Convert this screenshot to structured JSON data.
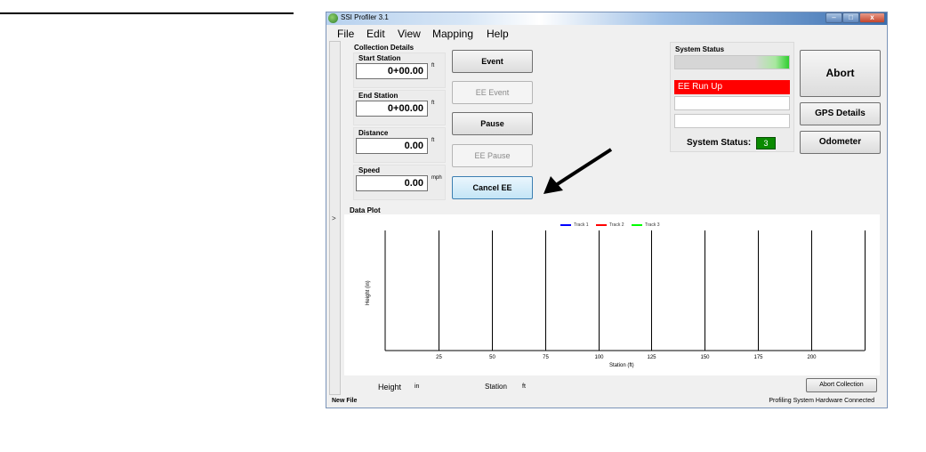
{
  "window": {
    "title": "SSI Profiler 3.1",
    "close_glyph": "x",
    "min_glyph": "–",
    "max_glyph": "□"
  },
  "menu": [
    "File",
    "Edit",
    "View",
    "Mapping",
    "Help"
  ],
  "side_panel": {
    "chevron": ">"
  },
  "collection": {
    "title": "Collection Details",
    "fields": [
      {
        "label": "Start Station",
        "value": "0+00.00",
        "unit": "ft"
      },
      {
        "label": "End Station",
        "value": "0+00.00",
        "unit": "ft"
      },
      {
        "label": "Distance",
        "value": "0.00",
        "unit": "ft"
      },
      {
        "label": "Speed",
        "value": "0.00",
        "unit": "mph"
      }
    ],
    "buttons": {
      "event": "Event",
      "ee_event": "EE Event",
      "pause": "Pause",
      "ee_pause": "EE Pause",
      "cancel_ee": "Cancel EE"
    }
  },
  "system_status": {
    "title": "System Status",
    "rows": [
      "",
      "EE Run Up",
      "",
      ""
    ],
    "status_label": "System Status:",
    "status_code": "3"
  },
  "right_buttons": {
    "abort": "Abort",
    "gps": "GPS Details",
    "odometer": "Odometer"
  },
  "data_plot": {
    "title": "Data Plot",
    "bottom_labels": {
      "height_label": "Height",
      "height_unit": "in",
      "station_label": "Station",
      "station_unit": "ft"
    },
    "abort_collection": "Abort Collection"
  },
  "chart_data": {
    "type": "line",
    "title": "",
    "xlabel": "Station (ft)",
    "ylabel": "Height (in)",
    "xlim": [
      0,
      225
    ],
    "x_ticks": [
      25,
      50,
      75,
      100,
      125,
      150,
      175,
      200
    ],
    "series": [
      {
        "name": "Track 1",
        "color": "#0000ff",
        "values": []
      },
      {
        "name": "Track 2",
        "color": "#ff0000",
        "values": []
      },
      {
        "name": "Track 3",
        "color": "#00ff00",
        "values": []
      }
    ],
    "grid": true,
    "legend": "top-center"
  },
  "status_bar": {
    "left": "New File",
    "right": "Profiling System Hardware Connected"
  },
  "annotation": {
    "arrow": "pointer-arrow"
  }
}
